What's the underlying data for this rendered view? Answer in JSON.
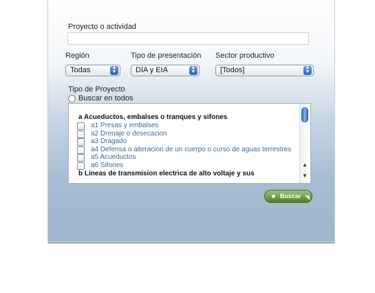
{
  "form": {
    "project_label": "Proyecto o actividad",
    "project_value": "",
    "region_label": "Región",
    "region_value": "Todas",
    "presentation_label": "Tipo de presentación",
    "presentation_value": "DIA y EIA",
    "sector_label": "Sector productivo",
    "sector_value": "[Todos]",
    "project_type_label": "Tipo de Proyecto",
    "search_all_label": "Buscar en todos",
    "search_button": "Buscar"
  },
  "list": {
    "group_a": "a Acueductos, embalses o tranques y sifones",
    "items": [
      "a1 Presas y embalses",
      "a2 Drenaje o desecacion",
      "a3 Dragado",
      "a4 Defensa o alteracion de un cuerpo o curso de aguas terrestres",
      "a5 Acueductos",
      "a6 Sifones"
    ],
    "group_b": "b Lineas de transmision electrica de alto voltaje y sus"
  }
}
